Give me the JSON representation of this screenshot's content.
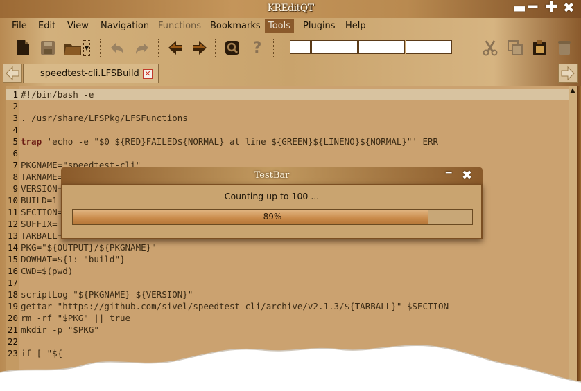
{
  "window": {
    "title": "KREditQT"
  },
  "menu": [
    "File",
    "Edit",
    "View",
    "Navigation",
    "Functions",
    "Bookmarks",
    "Tools",
    "Plugins",
    "Help"
  ],
  "tab": {
    "label": "speedtest-cli.LFSBuild"
  },
  "code_lines": [
    {
      "n": "1",
      "text": "#!/bin/bash -e"
    },
    {
      "n": "2",
      "text": ""
    },
    {
      "n": "3",
      "text": ". /usr/share/LFSPkg/LFSFunctions"
    },
    {
      "n": "4",
      "text": ""
    },
    {
      "n": "5",
      "text": "trap 'echo -e \"$0 ${RED}FAILED${NORMAL} at line ${GREEN}${LINENO}${NORMAL}\"' ERR"
    },
    {
      "n": "6",
      "text": ""
    },
    {
      "n": "7",
      "text": "PKGNAME=\"speedtest-cli\""
    },
    {
      "n": "8",
      "text": "TARNAME="
    },
    {
      "n": "9",
      "text": "VERSION="
    },
    {
      "n": "10",
      "text": "BUILD=1"
    },
    {
      "n": "11",
      "text": "SECTION="
    },
    {
      "n": "12",
      "text": "SUFFIX="
    },
    {
      "n": "13",
      "text": "TARBALL="
    },
    {
      "n": "14",
      "text": "PKG=\"${OUTPUT}/${PKGNAME}\""
    },
    {
      "n": "15",
      "text": "DOWHAT=${1:-\"build\"}"
    },
    {
      "n": "16",
      "text": "CWD=$(pwd)"
    },
    {
      "n": "17",
      "text": ""
    },
    {
      "n": "18",
      "text": "scriptLog \"${PKGNAME}-${VERSION}\""
    },
    {
      "n": "19",
      "text": "gettar \"https://github.com/sivel/speedtest-cli/archive/v2.1.3/${TARBALL}\" $SECTION"
    },
    {
      "n": "20",
      "text": "rm -rf \"$PKG\" || true"
    },
    {
      "n": "21",
      "text": "mkdir -p \"$PKG\""
    },
    {
      "n": "22",
      "text": ""
    },
    {
      "n": "23",
      "text": "if [ \"${"
    }
  ],
  "dialog": {
    "title": "TestBar",
    "message": "Counting up to 100 ...",
    "progress_label": "89%",
    "progress_value": 89
  },
  "colors": {
    "code_bg": "#cba270",
    "current_line": "#d8c3a0",
    "keyword": "#6a1a12",
    "active_menu": "#8b5a2b"
  }
}
